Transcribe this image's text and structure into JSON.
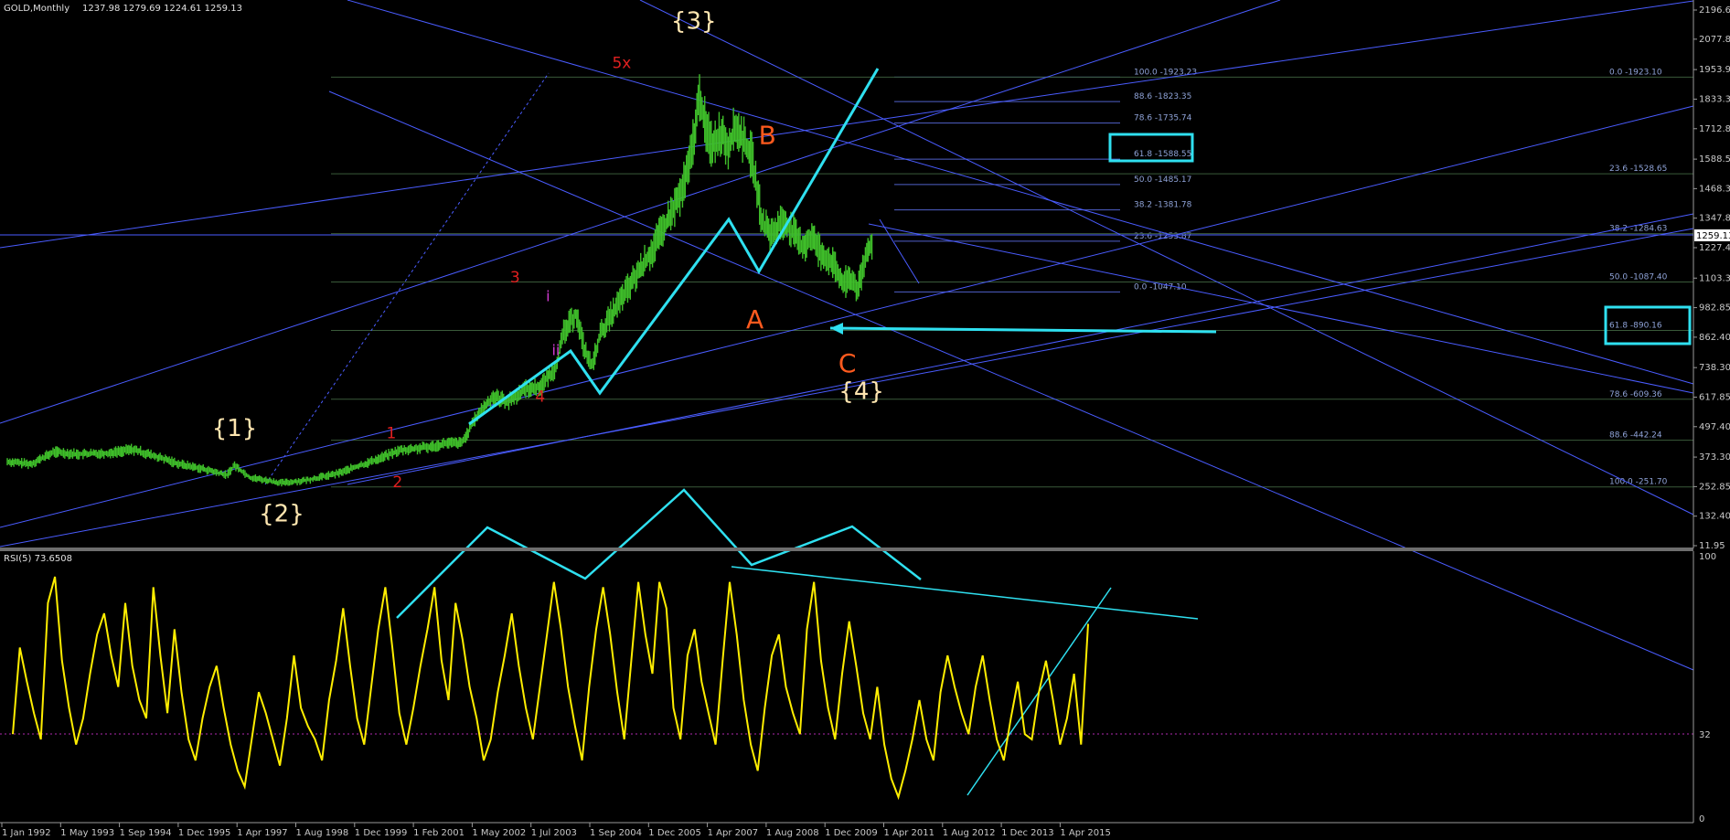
{
  "header": {
    "symbol": "GOLD,Monthly",
    "ohlc": "1237.98 1279.69 1224.61 1259.13",
    "rsi_label": "RSI(5) 73.6508"
  },
  "colors": {
    "background": "#000000",
    "price_bar": "#3fbf2a",
    "trend_line": "#4a5cff",
    "fib_line": "#3a5a3a",
    "cyan": "#2fe0f0",
    "rsi_line": "#ffee00",
    "rsi_level": "#b02ab0"
  },
  "chart_data": [
    {
      "type": "bar",
      "panel": "price",
      "title": "GOLD,Monthly",
      "ohlc_last": {
        "open": 1237.98,
        "high": 1279.69,
        "low": 1224.61,
        "close": 1259.13
      },
      "current_price": "1259.13",
      "y_ticks": [
        "2196.65",
        "2077.85",
        "1953.90",
        "1833.30",
        "1712.85",
        "1588.55",
        "1468.30",
        "1347.85",
        "1227.40",
        "1103.30",
        "982.85",
        "862.40",
        "738.30",
        "617.85",
        "497.40",
        "373.30",
        "252.85",
        "132.40",
        "11.95"
      ],
      "x_ticks": [
        "1 Jan 1992",
        "1 May 1993",
        "1 Sep 1994",
        "1 Dec 1995",
        "1 Apr 1997",
        "1 Aug 1998",
        "1 Dec 1999",
        "1 Feb 2001",
        "1 May 2002",
        "1 Jul 2003",
        "1 Sep 2004",
        "1 Dec 2005",
        "1 Apr 2007",
        "1 Aug 2008",
        "1 Dec 2009",
        "1 Apr 2011",
        "1 Aug 2012",
        "1 Dec 2013",
        "1 Apr 2015"
      ],
      "price_path": [
        {
          "t": 0.0,
          "v": 355
        },
        {
          "t": 1.5,
          "v": 345
        },
        {
          "t": 3.0,
          "v": 395
        },
        {
          "t": 4.5,
          "v": 385
        },
        {
          "t": 6.5,
          "v": 390
        },
        {
          "t": 8.0,
          "v": 405
        },
        {
          "t": 9.5,
          "v": 375
        },
        {
          "t": 11.0,
          "v": 345
        },
        {
          "t": 12.5,
          "v": 325
        },
        {
          "t": 14.0,
          "v": 300
        },
        {
          "t": 14.5,
          "v": 340
        },
        {
          "t": 15.5,
          "v": 290
        },
        {
          "t": 17.5,
          "v": 268
        },
        {
          "t": 19.0,
          "v": 278
        },
        {
          "t": 21.0,
          "v": 305
        },
        {
          "t": 23.0,
          "v": 350
        },
        {
          "t": 25.0,
          "v": 400
        },
        {
          "t": 27.0,
          "v": 415
        },
        {
          "t": 28.0,
          "v": 430
        },
        {
          "t": 29.0,
          "v": 430
        },
        {
          "t": 30.0,
          "v": 545
        },
        {
          "t": 31.0,
          "v": 620
        },
        {
          "t": 32.0,
          "v": 600
        },
        {
          "t": 33.0,
          "v": 650
        },
        {
          "t": 34.0,
          "v": 660
        },
        {
          "t": 35.0,
          "v": 740
        },
        {
          "t": 35.5,
          "v": 880
        },
        {
          "t": 36.3,
          "v": 960
        },
        {
          "t": 36.8,
          "v": 820
        },
        {
          "t": 37.3,
          "v": 740
        },
        {
          "t": 37.8,
          "v": 870
        },
        {
          "t": 38.5,
          "v": 950
        },
        {
          "t": 39.0,
          "v": 1000
        },
        {
          "t": 40.0,
          "v": 1100
        },
        {
          "t": 41.0,
          "v": 1200
        },
        {
          "t": 42.0,
          "v": 1320
        },
        {
          "t": 43.0,
          "v": 1450
        },
        {
          "t": 43.5,
          "v": 1560
        },
        {
          "t": 44.2,
          "v": 1850
        },
        {
          "t": 44.6,
          "v": 1700
        },
        {
          "t": 45.0,
          "v": 1650
        },
        {
          "t": 45.6,
          "v": 1700
        },
        {
          "t": 46.0,
          "v": 1640
        },
        {
          "t": 46.5,
          "v": 1720
        },
        {
          "t": 47.0,
          "v": 1660
        },
        {
          "t": 47.5,
          "v": 1600
        },
        {
          "t": 48.2,
          "v": 1320
        },
        {
          "t": 48.8,
          "v": 1280
        },
        {
          "t": 49.5,
          "v": 1340
        },
        {
          "t": 50.0,
          "v": 1300
        },
        {
          "t": 50.7,
          "v": 1230
        },
        {
          "t": 51.3,
          "v": 1270
        },
        {
          "t": 52.0,
          "v": 1200
        },
        {
          "t": 52.6,
          "v": 1170
        },
        {
          "t": 53.3,
          "v": 1080
        },
        {
          "t": 53.8,
          "v": 1100
        },
        {
          "t": 54.3,
          "v": 1060
        },
        {
          "t": 54.8,
          "v": 1190
        },
        {
          "t": 55.2,
          "v": 1259
        }
      ],
      "fib_levels_left": [
        {
          "label": "100.0 -1923.23",
          "v": 1923.23
        },
        {
          "label": "88.6 -1823.35",
          "v": 1823.35
        },
        {
          "label": "78.6 -1735.74",
          "v": 1735.74
        },
        {
          "label": "61.8 -1588.55",
          "v": 1588.55
        },
        {
          "label": "50.0 -1485.17",
          "v": 1485.17
        },
        {
          "label": "38.2 -1381.78",
          "v": 1381.78
        },
        {
          "label": "23.6 -1253.87",
          "v": 1253.87
        },
        {
          "label": "0.0 -1047.10",
          "v": 1047.1
        }
      ],
      "fib_levels_right": [
        {
          "label": "0.0 -1923.10",
          "v": 1923.1
        },
        {
          "label": "23.6 -1528.65",
          "v": 1528.65
        },
        {
          "label": "38.2 -1284.63",
          "v": 1284.63
        },
        {
          "label": "50.0 -1087.40",
          "v": 1087.4
        },
        {
          "label": "61.8 -890.16",
          "v": 890.16
        },
        {
          "label": "78.6 -609.36",
          "v": 609.36
        },
        {
          "label": "88.6 -442.24",
          "v": 442.24
        },
        {
          "label": "100.0 -251.70",
          "v": 251.7
        }
      ],
      "wave_labels": [
        {
          "text": "{1}",
          "style": "white",
          "t": 14.5,
          "v": 460
        },
        {
          "text": "{2}",
          "style": "white",
          "t": 17.5,
          "v": 110
        },
        {
          "text": "{3}",
          "style": "white",
          "t": 43.8,
          "v": 2120
        },
        {
          "text": "{4}",
          "style": "white",
          "t": 54.5,
          "v": 610
        },
        {
          "text": "1",
          "style": "red",
          "t": 24.5,
          "v": 450
        },
        {
          "text": "2",
          "style": "red",
          "t": 24.9,
          "v": 250
        },
        {
          "text": "3",
          "style": "red",
          "t": 32.4,
          "v": 1085
        },
        {
          "text": "4",
          "style": "red",
          "t": 34.0,
          "v": 600
        },
        {
          "text": "5x",
          "style": "red",
          "t": 39.2,
          "v": 1960
        },
        {
          "text": "i",
          "style": "magenta",
          "t": 34.5,
          "v": 1010
        },
        {
          "text": "ii",
          "style": "magenta",
          "t": 35.0,
          "v": 790
        },
        {
          "text": "A",
          "style": "orange",
          "t": 47.7,
          "v": 900
        },
        {
          "text": "B",
          "style": "orange",
          "t": 48.5,
          "v": 1650
        },
        {
          "text": "C",
          "style": "orange",
          "t": 53.6,
          "v": 720
        }
      ]
    },
    {
      "type": "line",
      "panel": "rsi",
      "title": "RSI(5) 73.6508",
      "ylim": [
        0,
        100
      ],
      "y_ticks": [
        "100",
        "32",
        "0"
      ],
      "level": 32,
      "last_value": 73.6508,
      "values": [
        32,
        65,
        52,
        40,
        30,
        82,
        92,
        60,
        42,
        28,
        38,
        55,
        70,
        78,
        62,
        50,
        82,
        58,
        45,
        38,
        88,
        62,
        40,
        72,
        48,
        30,
        22,
        38,
        50,
        58,
        42,
        28,
        18,
        12,
        30,
        48,
        40,
        30,
        20,
        38,
        62,
        42,
        35,
        30,
        22,
        45,
        60,
        80,
        58,
        38,
        28,
        50,
        72,
        88,
        65,
        40,
        28,
        42,
        58,
        72,
        88,
        60,
        45,
        82,
        68,
        50,
        38,
        22,
        30,
        48,
        62,
        78,
        58,
        42,
        30,
        50,
        70,
        90,
        72,
        50,
        35,
        22,
        50,
        72,
        88,
        70,
        48,
        30,
        60,
        90,
        70,
        55,
        90,
        80,
        42,
        30,
        62,
        72,
        52,
        40,
        28,
        60,
        90,
        70,
        45,
        28,
        18,
        42,
        62,
        70,
        50,
        40,
        32,
        72,
        90,
        60,
        42,
        30,
        55,
        75,
        58,
        40,
        30,
        50,
        28,
        15,
        8,
        18,
        30,
        45,
        30,
        22,
        48,
        62,
        50,
        40,
        32,
        50,
        62,
        45,
        30,
        22,
        38,
        52,
        32,
        30,
        48,
        60,
        45,
        28,
        38,
        55,
        28,
        74
      ]
    }
  ]
}
